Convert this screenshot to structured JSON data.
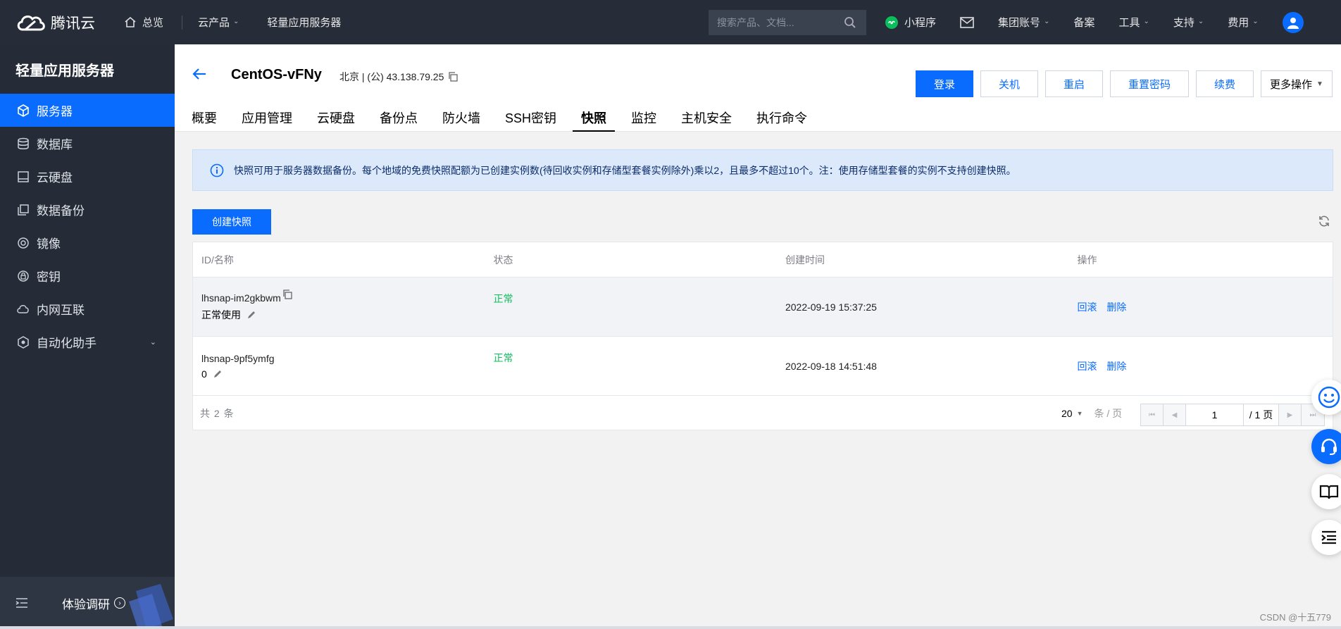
{
  "topbar": {
    "brand": "腾讯云",
    "home": "总览",
    "menu": [
      {
        "label": "云产品",
        "caret": true
      },
      {
        "label": "轻量应用服务器",
        "caret": false
      }
    ],
    "search_placeholder": "搜索产品、文档...",
    "right": [
      {
        "label": "小程序",
        "icon": "miniprogram-icon"
      },
      {
        "label": "",
        "icon": "mail-icon"
      },
      {
        "label": "集团账号",
        "caret": true
      },
      {
        "label": "备案"
      },
      {
        "label": "工具",
        "caret": true
      },
      {
        "label": "支持",
        "caret": true
      },
      {
        "label": "费用",
        "caret": true
      }
    ]
  },
  "sidebar": {
    "title": "轻量应用服务器",
    "items": [
      {
        "label": "服务器",
        "icon": "cube-icon",
        "active": true
      },
      {
        "label": "数据库",
        "icon": "database-icon"
      },
      {
        "label": "云硬盘",
        "icon": "disk-icon"
      },
      {
        "label": "数据备份",
        "icon": "backup-icon"
      },
      {
        "label": "镜像",
        "icon": "image-icon"
      },
      {
        "label": "密钥",
        "icon": "key-icon"
      },
      {
        "label": "内网互联",
        "icon": "network-icon"
      },
      {
        "label": "自动化助手",
        "icon": "automation-icon",
        "caret": true
      }
    ],
    "footer_label": "体验调研"
  },
  "instance": {
    "name": "CentOS-vFNy",
    "location": "北京 | (公) 43.138.79.25"
  },
  "actions": {
    "login": "登录",
    "shutdown": "关机",
    "restart": "重启",
    "reset_password": "重置密码",
    "renew": "续费",
    "more": "更多操作"
  },
  "tabs": [
    "概要",
    "应用管理",
    "云硬盘",
    "备份点",
    "防火墙",
    "SSH密钥",
    "快照",
    "监控",
    "主机安全",
    "执行命令"
  ],
  "active_tab": "快照",
  "notice": "快照可用于服务器数据备份。每个地域的免费快照配额为已创建实例数(待回收实例和存储型套餐实例除外)乘以2，且最多不超过10个。注：使用存储型套餐的实例不支持创建快照。",
  "create_button": "创建快照",
  "table": {
    "headers": [
      "ID/名称",
      "状态",
      "创建时间",
      "操作"
    ],
    "rows": [
      {
        "id": "lhsnap-im2gkbwm",
        "name": "正常使用",
        "status": "正常",
        "created": "2022-09-19 15:37:25",
        "op_rollback": "回滚",
        "op_delete": "删除"
      },
      {
        "id": "lhsnap-9pf5ymfg",
        "name": "0",
        "status": "正常",
        "created": "2022-09-18 14:51:48",
        "op_rollback": "回滚",
        "op_delete": "删除"
      }
    ],
    "footer": {
      "total": "共 2 条",
      "page_size": "20",
      "page_size_unit": "条 / 页",
      "current_page": "1",
      "total_pages": "/ 1 页"
    }
  },
  "watermark": "CSDN @十五779",
  "colors": {
    "primary": "#0a6cff",
    "nav_bg": "#262c38",
    "success": "#0abf5b",
    "notice_bg": "#dce9fb"
  }
}
